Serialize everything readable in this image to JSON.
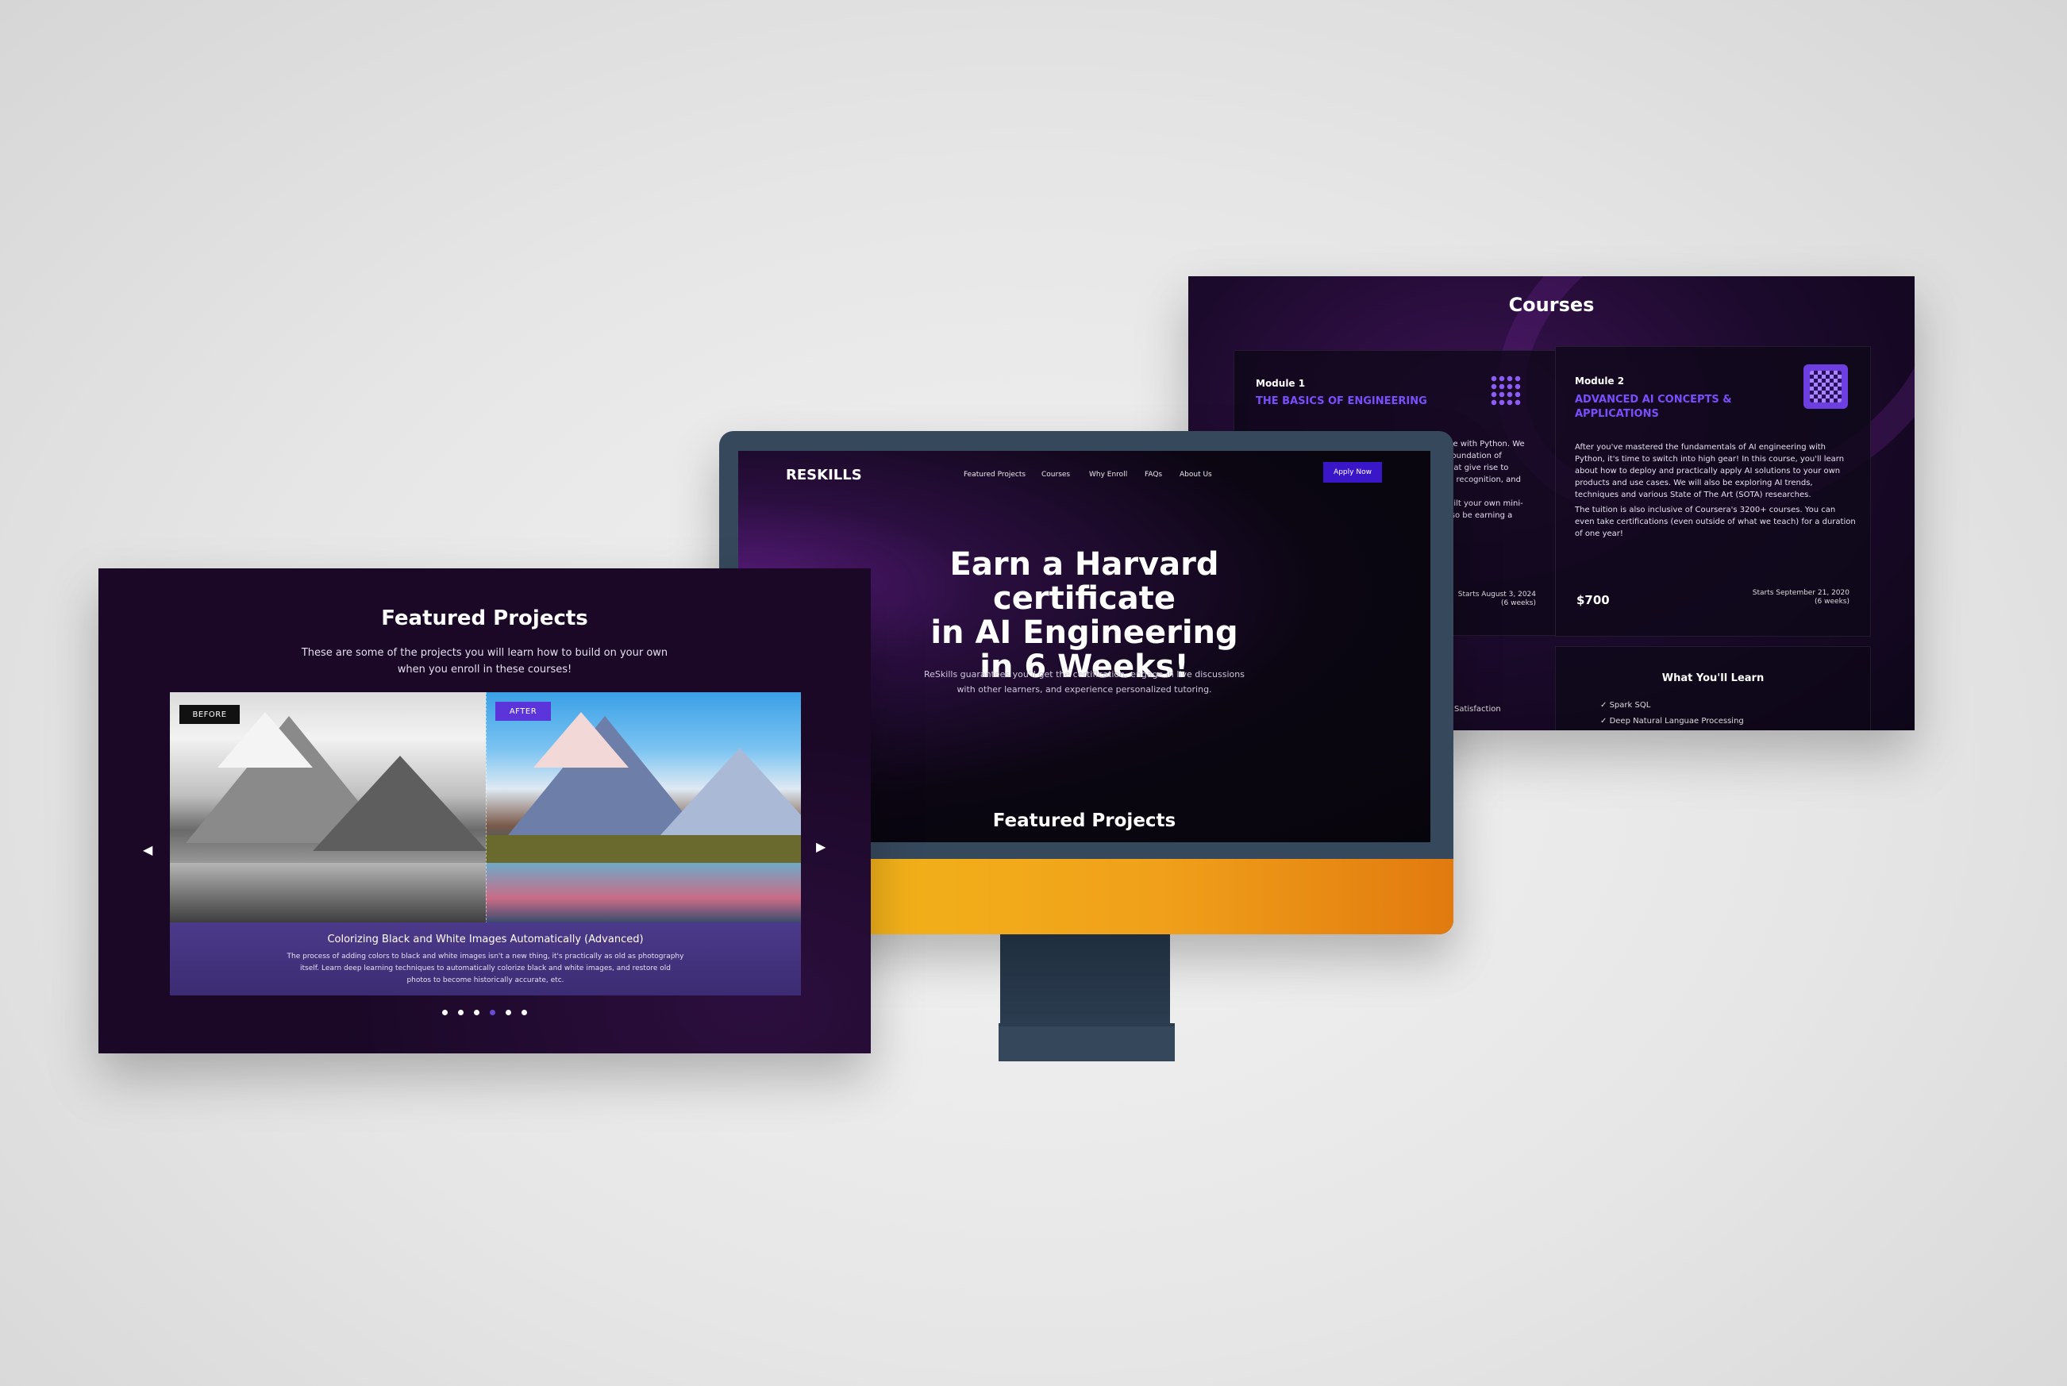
{
  "courses_panel": {
    "title": "Courses",
    "module1": {
      "label": "Module 1",
      "name": "THE BASICS OF ENGINEERING",
      "body_lines": [
        "ce with Python. We",
        "foundation of",
        "hat give rise to",
        "g recognition, and",
        "",
        "uilt your own mini-",
        "lso be earning a"
      ],
      "start": "Starts August 3, 2024",
      "duration": "(6 weeks)"
    },
    "module2": {
      "label": "Module 2",
      "name_line1": "ADVANCED AI CONCEPTS &",
      "name_line2": "APPLICATIONS",
      "body_p1": "After you've mastered the fundamentals of AI engineering with Python, it's time to switch into high gear! In this course, you'll learn about how to deploy and practically apply AI solutions to your own products and use cases. We will also be exploring AI trends, techniques and various State of The Art (SOTA) researches.",
      "body_p2": "The tuition is also inclusive of Coursera's 3200+ courses. You can even take certifications (even outside of what we teach) for a duration of one year!",
      "price": "$700",
      "start": "Starts September 21, 2020",
      "duration": "(6 weeks)"
    },
    "partial_left": "Satisfaction",
    "learn": {
      "title": "What You'll Learn",
      "items": [
        "Spark SQL",
        "Deep Natural Languae Processing"
      ]
    }
  },
  "monitor": {
    "brand": "RESKILLS",
    "nav": [
      "Featured Projects",
      "Courses",
      "Why Enroll",
      "FAQs",
      "About Us"
    ],
    "apply": "Apply Now",
    "hero_line1": "Earn a Harvard certificate",
    "hero_line2": "in AI Engineering",
    "hero_line3": "in 6 Weeks!",
    "hero_sub_line1": "ReSkills guarantees you'll get the certification, engage in live discussions",
    "hero_sub_line2": "with other learners, and experience personalized tutoring.",
    "featured": "Featured Projects"
  },
  "projects_panel": {
    "title": "Featured Projects",
    "sub_line1": "These are some of the projects you will learn how to build on your own",
    "sub_line2": "when you enroll in these courses!",
    "before": "BEFORE",
    "after": "AFTER",
    "caption_title": "Colorizing Black and White Images Automatically (Advanced)",
    "caption_line1": "The process of adding colors to black and white images isn't a new thing, it's practically as old as photography",
    "caption_line2": "itself. Learn deep learning techniques to automatically colorize black and white images, and restore old",
    "caption_line3": "photos to become historically accurate, etc.",
    "prev": "◀",
    "next": "▶",
    "dot_count": 6,
    "active_dot": 4
  },
  "colors": {
    "accent_purple": "#7b4dff",
    "apply_button": "#3a16c9",
    "monitor_chin": "#f0a01a",
    "monitor_body": "#36495c"
  }
}
